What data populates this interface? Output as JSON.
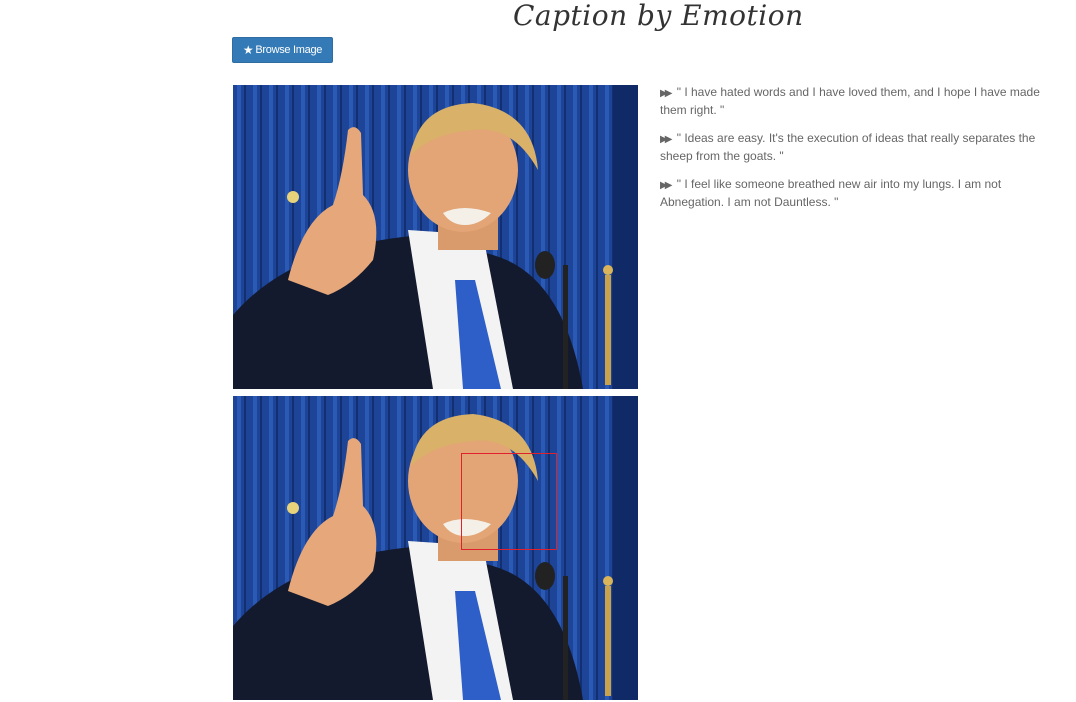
{
  "header": {
    "title": "Caption by Emotion"
  },
  "toolbar": {
    "browse_label": "Browse Image",
    "browse_icon": "star-icon"
  },
  "captions": [
    {
      "icon": "fast-forward-icon",
      "text": "\" I have hated words and I have loved them, and I hope I have made them right. \""
    },
    {
      "icon": "fast-forward-icon",
      "text": "\" Ideas are easy. It's the execution of ideas that really separates the sheep from the goats. \""
    },
    {
      "icon": "fast-forward-icon",
      "text": "\" I feel like someone breathed new air into my lungs. I am not Abnegation. I am not Dauntless. \""
    }
  ],
  "colors": {
    "button": "#337ab7",
    "caption_text": "#666666",
    "face_box": "#e0202a",
    "curtain": "#1a3f8c"
  }
}
